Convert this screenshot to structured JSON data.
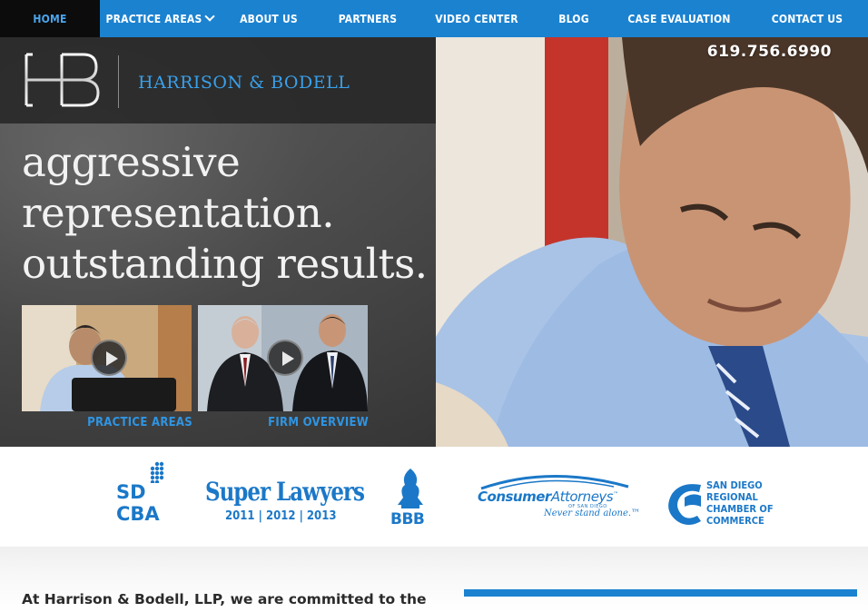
{
  "nav": {
    "items": [
      {
        "label": "HOME",
        "active": true
      },
      {
        "label": "PRACTICE AREAS",
        "dropdown": true
      },
      {
        "label": "ABOUT US"
      },
      {
        "label": "PARTNERS"
      },
      {
        "label": "VIDEO CENTER"
      },
      {
        "label": "BLOG"
      },
      {
        "label": "CASE EVALUATION"
      },
      {
        "label": "CONTACT US"
      }
    ]
  },
  "header": {
    "logo_mark": "HB",
    "firm_name": "HARRISON & BODELL",
    "phone": "619.756.6990"
  },
  "hero": {
    "tagline": [
      "aggressive",
      "representation.",
      "outstanding results."
    ],
    "videos": [
      {
        "label": "PRACTICE AREAS",
        "icon": "play-icon"
      },
      {
        "label": "FIRM OVERVIEW",
        "icon": "play-icon"
      }
    ]
  },
  "badges": {
    "sdcba": {
      "line1": "SD",
      "line2": "CBA"
    },
    "super_lawyers": {
      "title": "Super Lawyers",
      "years": "2011 | 2012 | 2013"
    },
    "bbb": {
      "label": "BBB"
    },
    "consumer_attorneys": {
      "bold": "Consumer",
      "light": "Attorneys",
      "trademark": "™",
      "sub": "OF SAN DIEGO",
      "slogan": "Never stand alone.™"
    },
    "chamber": {
      "lines": [
        "SAN DIEGO",
        "REGIONAL",
        "CHAMBER OF",
        "COMMERCE"
      ]
    }
  },
  "content": {
    "intro": "At Harrison & Bodell, LLP, we are committed to the"
  },
  "colors": {
    "brand_blue": "#1b82d0",
    "nav_active_bg": "#0c0c0c",
    "hero_dark": "#404040"
  }
}
